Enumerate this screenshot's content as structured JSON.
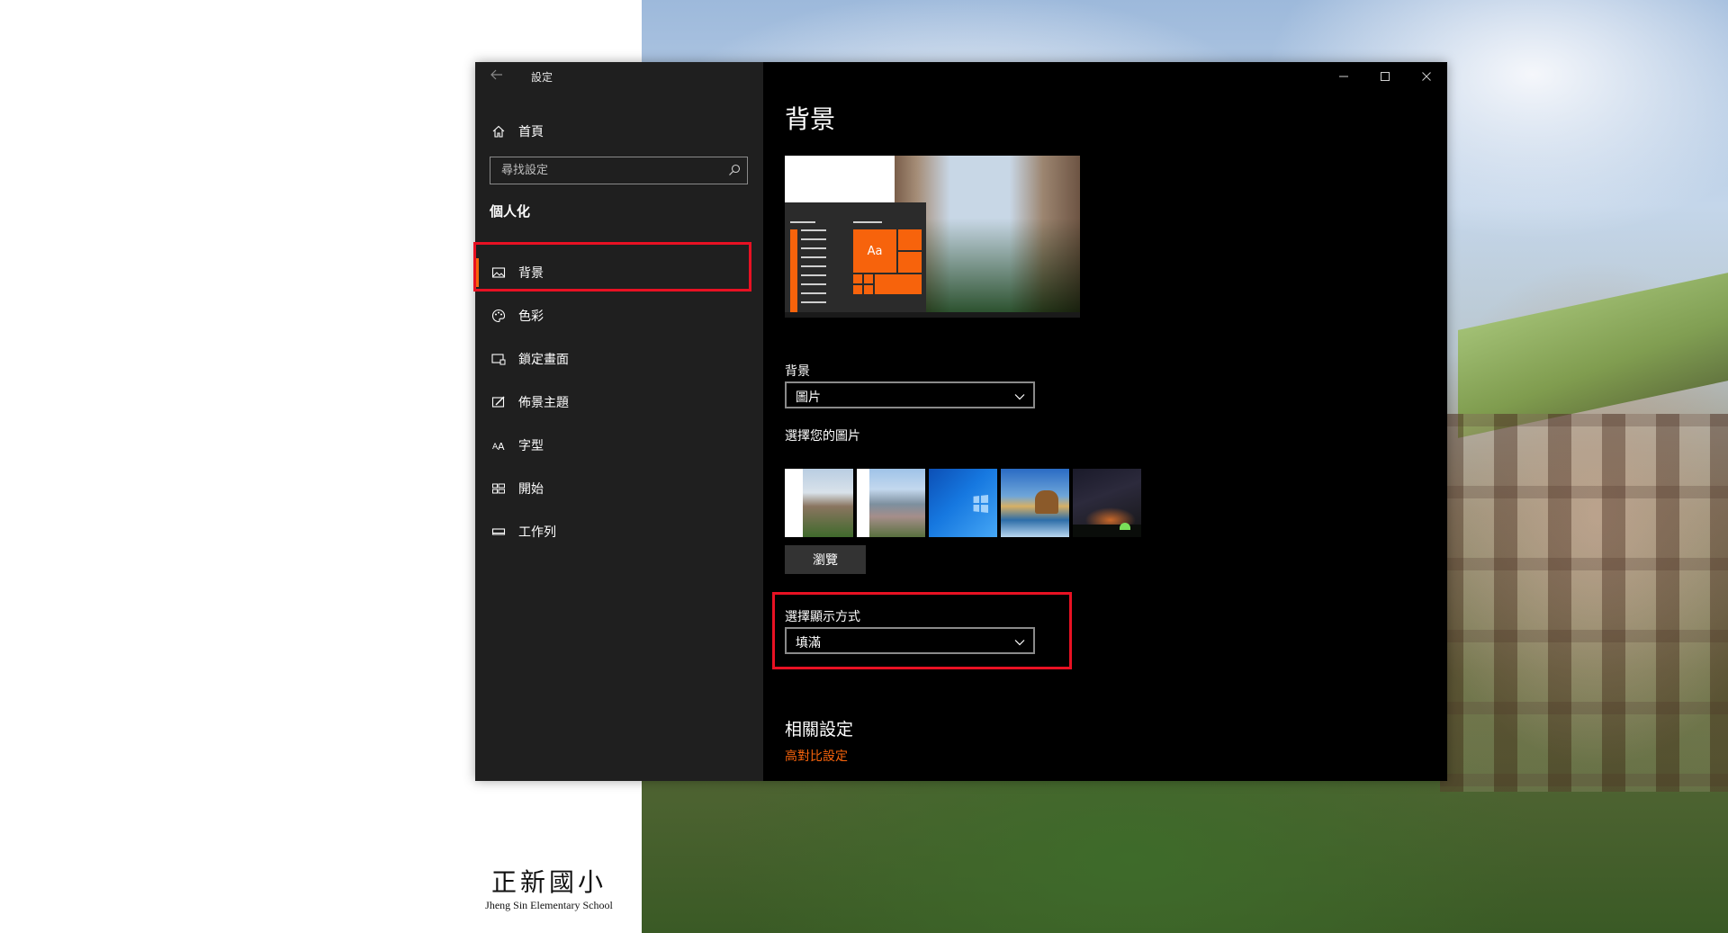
{
  "window": {
    "app_title": "設定",
    "controls": {
      "minimize": "—",
      "maximize": "☐",
      "close": "✕"
    }
  },
  "sidebar": {
    "home_label": "首頁",
    "search_placeholder": "尋找設定",
    "section_title": "個人化",
    "items": [
      {
        "label": "背景",
        "icon": "picture-icon",
        "selected": true
      },
      {
        "label": "色彩",
        "icon": "palette-icon",
        "selected": false
      },
      {
        "label": "鎖定畫面",
        "icon": "lock-screen-icon",
        "selected": false
      },
      {
        "label": "佈景主題",
        "icon": "theme-icon",
        "selected": false
      },
      {
        "label": "字型",
        "icon": "font-icon",
        "selected": false
      },
      {
        "label": "開始",
        "icon": "start-icon",
        "selected": false
      },
      {
        "label": "工作列",
        "icon": "taskbar-icon",
        "selected": false
      }
    ]
  },
  "main": {
    "page_title": "背景",
    "preview": {
      "sample_text": "Aa"
    },
    "background_field": {
      "label": "背景",
      "value": "圖片"
    },
    "choose_picture": {
      "label": "選擇您的圖片",
      "browse_label": "瀏覽"
    },
    "fit_field": {
      "label": "選擇顯示方式",
      "value": "填滿"
    },
    "related": {
      "title": "相關設定",
      "link": "高對比設定"
    }
  },
  "desktop": {
    "logo_cn": "正新國小",
    "logo_en": "Jheng Sin Elementary School"
  },
  "colors": {
    "accent": "#f7630c",
    "highlight_box": "#e81123",
    "sidebar_bg": "#1f1f1f",
    "main_bg": "#000000"
  }
}
